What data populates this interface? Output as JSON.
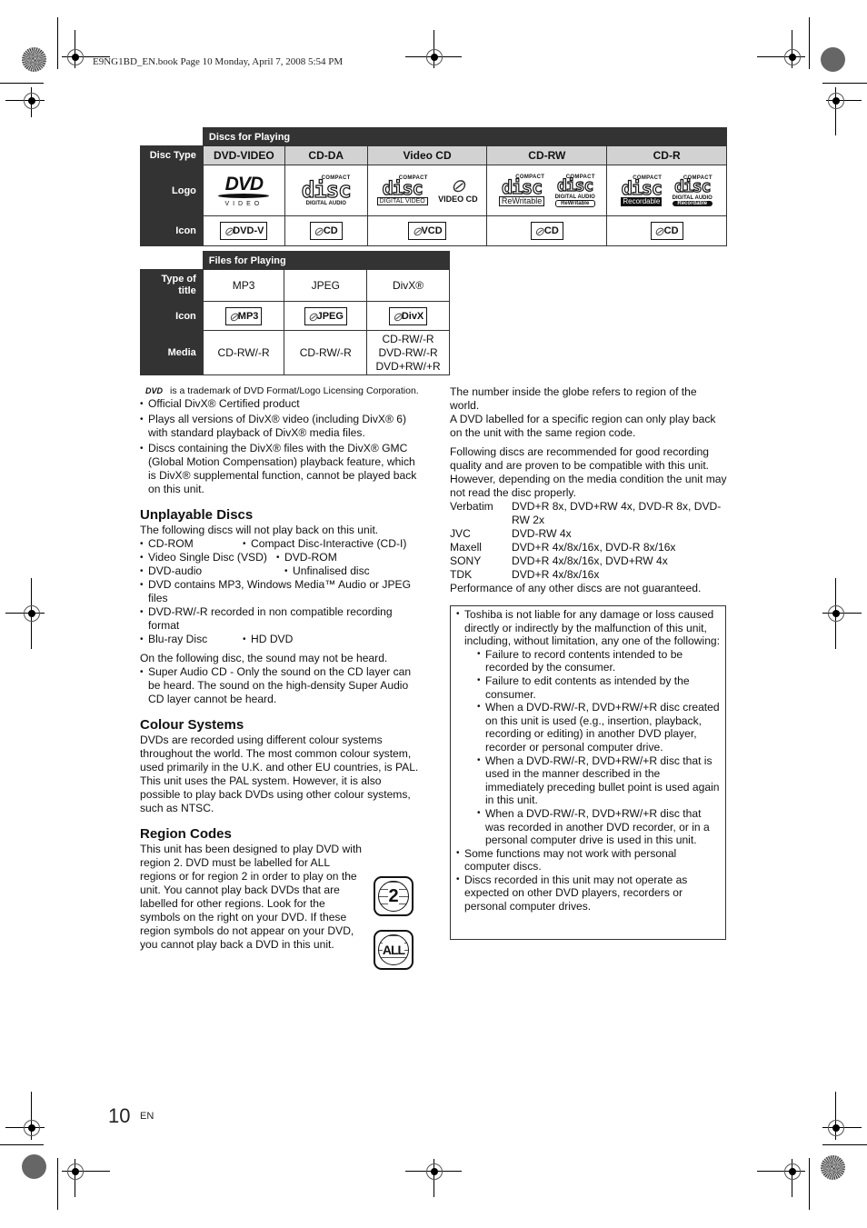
{
  "print_header": "E9NG1BD_EN.book  Page 10  Monday, April 7, 2008  5:54 PM",
  "discs_table": {
    "banner": "Discs for Playing",
    "row_labels": {
      "type": "Disc Type",
      "logo": "Logo",
      "icon": "Icon"
    },
    "columns": [
      {
        "type": "DVD-VIDEO",
        "logos": [
          {
            "kind": "dvd",
            "sub": "VIDEO"
          }
        ],
        "icon": "DVD-V"
      },
      {
        "type": "CD-DA",
        "logos": [
          {
            "kind": "disc",
            "top": "COMPACT",
            "sub": "DIGITAL AUDIO"
          }
        ],
        "icon": "CD"
      },
      {
        "type": "Video CD",
        "logos": [
          {
            "kind": "disc",
            "top": "COMPACT",
            "sub": "DIGITAL VIDEO"
          },
          {
            "kind": "vcd",
            "sub": "VIDEO CD"
          }
        ],
        "icon": "VCD"
      },
      {
        "type": "CD-RW",
        "logos": [
          {
            "kind": "disc",
            "top": "COMPACT",
            "sub": "ReWritable"
          },
          {
            "kind": "disc",
            "top": "COMPACT",
            "sub2": "DIGITAL AUDIO",
            "sub": "ReWritable"
          }
        ],
        "icon": "CD"
      },
      {
        "type": "CD-R",
        "logos": [
          {
            "kind": "disc",
            "top": "COMPACT",
            "sub": "Recordable"
          },
          {
            "kind": "disc",
            "top": "COMPACT",
            "sub2": "DIGITAL AUDIO",
            "sub": "Recordable"
          }
        ],
        "icon": "CD"
      }
    ]
  },
  "files_table": {
    "banner": "Files for Playing",
    "row_labels": {
      "type": "Type of title",
      "icon": "Icon",
      "media": "Media"
    },
    "columns": [
      {
        "type": "MP3",
        "icon": "MP3",
        "media": "CD-RW/-R"
      },
      {
        "type": "JPEG",
        "icon": "JPEG",
        "media": "CD-RW/-R"
      },
      {
        "type": "DivX®",
        "icon": "DivX",
        "media": "CD-RW/-R\nDVD-RW/-R\nDVD+RW/+R"
      }
    ]
  },
  "left": {
    "trademark_note": "is a trademark of DVD Format/Logo Licensing Corporation.",
    "divx_bullets": [
      "Official DivX® Certified product",
      "Plays all versions of DivX® video (including DivX® 6) with standard playback of DivX® media files.",
      "Discs containing the DivX® files with the DivX® GMC (Global Motion Compensation) playback feature, which is DivX® supplemental function, cannot be played back on this unit."
    ],
    "unplayable": {
      "heading": "Unplayable Discs",
      "intro": "The following discs will not play back on this unit.",
      "pairs": [
        [
          "CD-ROM",
          "Compact Disc-Interactive (CD-I)"
        ],
        [
          "Video Single Disc (VSD)",
          "DVD-ROM"
        ],
        [
          "DVD-audio",
          "Unfinalised disc"
        ]
      ],
      "singles": [
        "DVD contains MP3, Windows Media™ Audio or JPEG files",
        "DVD-RW/-R recorded in non compatible recording format"
      ],
      "last_pair": [
        "Blu-ray Disc",
        "HD DVD"
      ],
      "sound_intro": "On the following disc, the sound may not be heard.",
      "sound_bullet": "Super Audio CD - Only the sound on the CD layer can be heard. The sound on the high-density Super Audio CD layer cannot be heard."
    },
    "colour": {
      "heading": "Colour Systems",
      "p1": "DVDs are recorded using different colour systems throughout the world. The most common colour system, used primarily in the U.K. and other EU countries, is PAL.",
      "p2": "This unit uses the PAL system. However, it is also possible to play back DVDs using other colour systems, such as NTSC."
    },
    "region": {
      "heading": "Region Codes",
      "body": "This unit has been designed to play DVD with region 2. DVD must be labelled for ALL regions or for region 2 in order to play on the unit. You cannot play back DVDs that are labelled for other regions. Look for the symbols on the right on your DVD. If these region symbols do not appear on your DVD, you cannot play back a DVD in this unit.",
      "icons": [
        "2",
        "ALL"
      ]
    }
  },
  "right": {
    "globe_p1": "The number inside the globe refers to region of the world.",
    "globe_p2": "A DVD labelled for a specific region can only play back on the unit with the same region code.",
    "recommend_intro": "Following discs are recommended for good recording quality and are proven to be compatible with this unit. However, depending on the media condition the unit may not read the disc properly.",
    "recommended": [
      {
        "brand": "Verbatim",
        "discs": "DVD+R 8x, DVD+RW 4x, DVD-R 8x, DVD-RW 2x"
      },
      {
        "brand": "JVC",
        "discs": "DVD-RW 4x"
      },
      {
        "brand": "Maxell",
        "discs": "DVD+R 4x/8x/16x, DVD-R 8x/16x"
      },
      {
        "brand": "SONY",
        "discs": "DVD+R 4x/8x/16x, DVD+RW 4x"
      },
      {
        "brand": "TDK",
        "discs": "DVD+R 4x/8x/16x"
      }
    ],
    "performance_note": "Performance of any other discs are not guaranteed.",
    "notice": {
      "main": "Toshiba is not liable for any damage or loss caused directly or indirectly by the malfunction of this unit, including, without limitation, any one of the following:",
      "sub": [
        "Failure to record contents intended to be recorded by the consumer.",
        "Failure to edit contents as intended by the consumer.",
        "When a DVD-RW/-R, DVD+RW/+R disc created on this unit is used (e.g., insertion, playback, recording or editing) in another DVD player, recorder or personal computer drive.",
        "When a DVD-RW/-R, DVD+RW/+R disc that is used in the manner described in the immediately preceding bullet point is used again in this unit.",
        "When a DVD-RW/-R, DVD+RW/+R disc that was recorded in another DVD recorder, or in a personal computer drive is used in this unit."
      ],
      "extra": [
        "Some functions may not work with personal computer discs.",
        "Discs recorded in this unit may not operate as expected on other DVD players, recorders or personal computer drives."
      ]
    }
  },
  "footer": {
    "page_number": "10",
    "language": "EN"
  }
}
